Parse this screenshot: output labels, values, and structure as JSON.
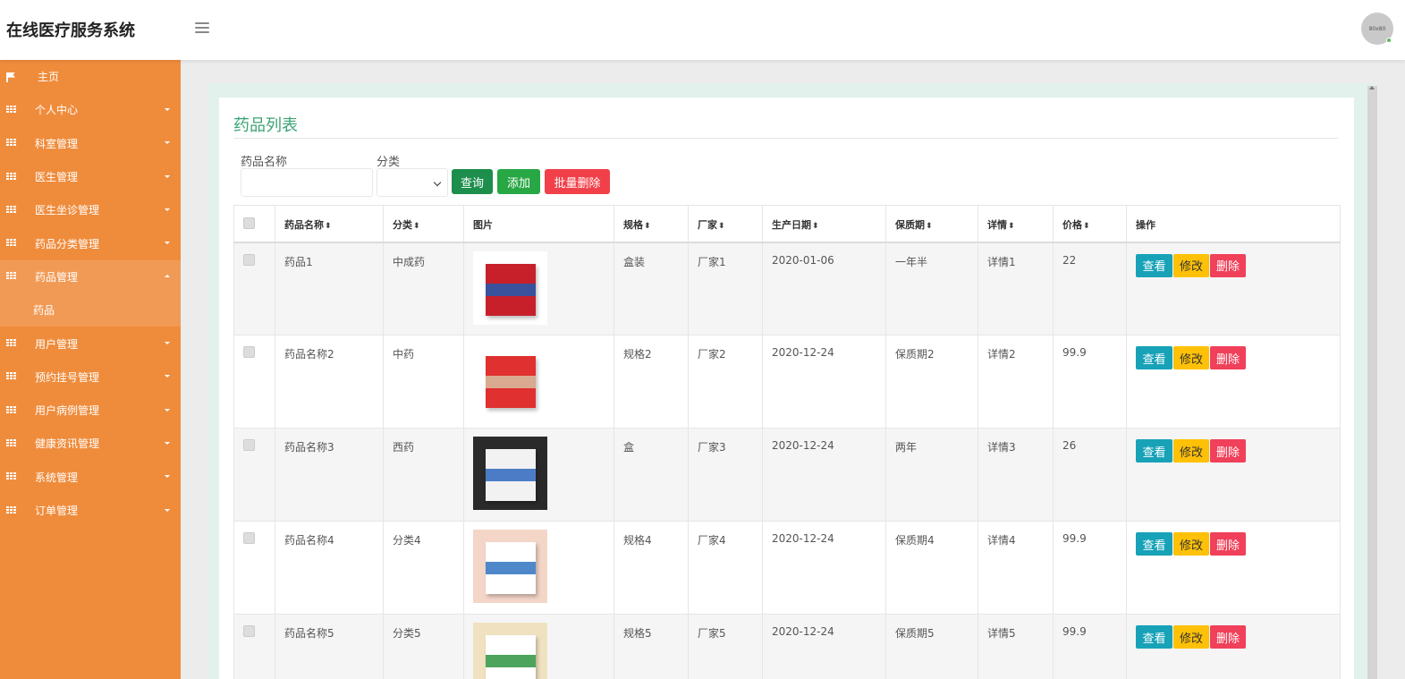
{
  "header": {
    "app_title": "在线医疗服务系统",
    "avatar_text": "80x80"
  },
  "sidebar": {
    "items": [
      {
        "label": "主页",
        "icon": "flag-icon",
        "caret": "none"
      },
      {
        "label": "个人中心",
        "icon": "grid-icon",
        "caret": "down"
      },
      {
        "label": "科室管理",
        "icon": "grid-icon",
        "caret": "down"
      },
      {
        "label": "医生管理",
        "icon": "grid-icon",
        "caret": "down"
      },
      {
        "label": "医生坐诊管理",
        "icon": "grid-icon",
        "caret": "down"
      },
      {
        "label": "药品分类管理",
        "icon": "grid-icon",
        "caret": "down"
      },
      {
        "label": "药品管理",
        "icon": "grid-icon",
        "caret": "up"
      },
      {
        "label": "用户管理",
        "icon": "grid-icon",
        "caret": "down"
      },
      {
        "label": "预约挂号管理",
        "icon": "grid-icon",
        "caret": "down"
      },
      {
        "label": "用户病例管理",
        "icon": "grid-icon",
        "caret": "down"
      },
      {
        "label": "健康资讯管理",
        "icon": "grid-icon",
        "caret": "down"
      },
      {
        "label": "系统管理",
        "icon": "grid-icon",
        "caret": "down"
      },
      {
        "label": "订单管理",
        "icon": "grid-icon",
        "caret": "down"
      }
    ],
    "sub_item": "药品"
  },
  "page": {
    "title": "药品列表",
    "filters": {
      "name_label": "药品名称",
      "name_value": "",
      "category_label": "分类",
      "category_value": ""
    },
    "buttons": {
      "query": "查询",
      "add": "添加",
      "batch_delete": "批量删除"
    }
  },
  "table": {
    "headers": [
      "药品名称",
      "分类",
      "图片",
      "规格",
      "厂家",
      "生产日期",
      "保质期",
      "详情",
      "价格",
      "操作"
    ],
    "sort_icon": "⬍",
    "row_actions": {
      "view": "查看",
      "edit": "修改",
      "delete": "删除"
    },
    "rows": [
      {
        "name": "药品1",
        "category": "中成药",
        "spec": "盒装",
        "maker": "厂家1",
        "date": "2020-01-06",
        "shelf": "一年半",
        "detail": "详情1",
        "price": "22",
        "thumb_colors": [
          "#ffffff",
          "#c8202a",
          "#2a56a8"
        ]
      },
      {
        "name": "药品名称2",
        "category": "中药",
        "spec": "规格2",
        "maker": "厂家2",
        "date": "2020-12-24",
        "shelf": "保质期2",
        "detail": "详情2",
        "price": "99.9",
        "thumb_colors": [
          "#ffffff",
          "#e03030",
          "#d8b89a"
        ]
      },
      {
        "name": "药品名称3",
        "category": "西药",
        "spec": "盒",
        "maker": "厂家3",
        "date": "2020-12-24",
        "shelf": "两年",
        "detail": "详情3",
        "price": "26",
        "thumb_colors": [
          "#2a2a2a",
          "#f2f2f2",
          "#3a6fc0"
        ]
      },
      {
        "name": "药品名称4",
        "category": "分类4",
        "spec": "规格4",
        "maker": "厂家4",
        "date": "2020-12-24",
        "shelf": "保质期4",
        "detail": "详情4",
        "price": "99.9",
        "thumb_colors": [
          "#f4d6c8",
          "#ffffff",
          "#3b7bc4"
        ]
      },
      {
        "name": "药品名称5",
        "category": "分类5",
        "spec": "规格5",
        "maker": "厂家5",
        "date": "2020-12-24",
        "shelf": "保质期5",
        "detail": "详情5",
        "price": "99.9",
        "thumb_colors": [
          "#f0e2c0",
          "#ffffff",
          "#3a9a4a"
        ]
      }
    ]
  },
  "colors": {
    "sidebar": "#ef8c3c",
    "sidebar_active": "#f19a55",
    "title_green": "#3aa374",
    "btn_query": "#1d8e4c",
    "btn_add": "#28a745",
    "btn_batch": "#f2404a",
    "op_view": "#17a2b8",
    "op_edit": "#ffc107",
    "op_delete": "#f0405a"
  }
}
